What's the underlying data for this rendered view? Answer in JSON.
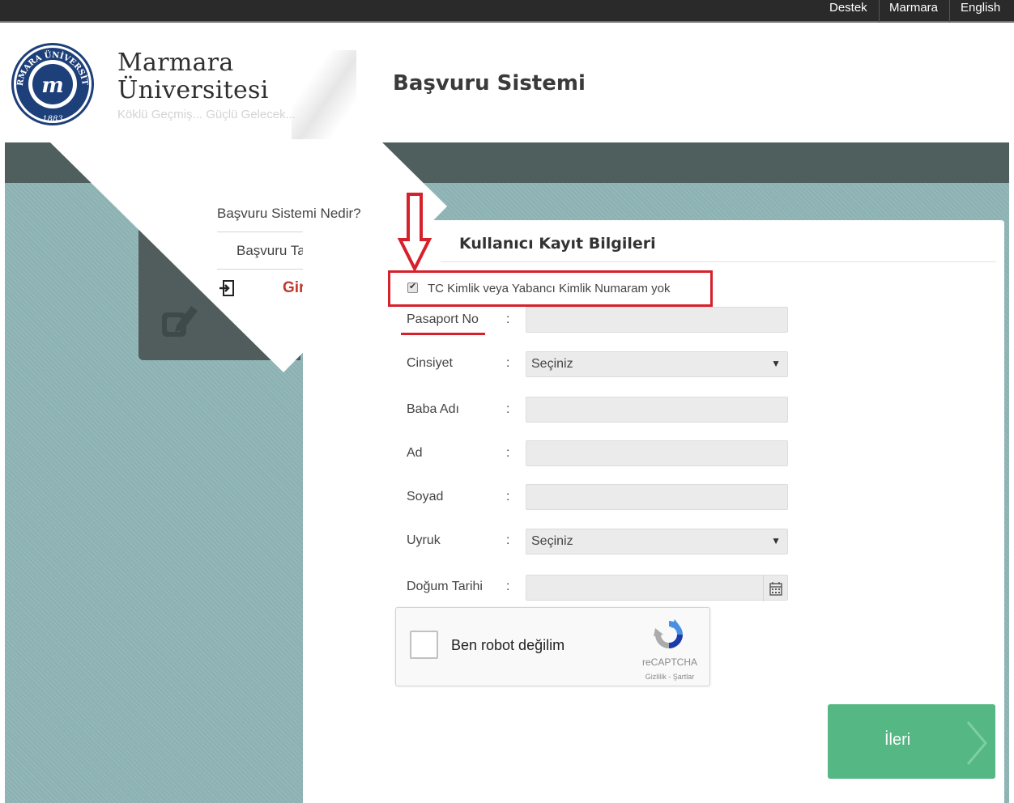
{
  "topbar": {
    "links": [
      "Destek",
      "Marmara",
      "English"
    ]
  },
  "header": {
    "seal_text": "MARMARA ÜNİVERSİTESİ",
    "seal_year": "1883",
    "brand_line1": "Marmara",
    "brand_line2": "Üniversitesi",
    "motto": "Köklü Geçmiş... Güçlü Gelecek...",
    "app_title": "Başvuru Sistemi"
  },
  "nav": {
    "items": [
      "Başvuru Sistemi Nedir?",
      "Başvuru Tarihleri"
    ],
    "login_label": "Giriş"
  },
  "form": {
    "title": "Kullanıcı Kayıt Bilgileri",
    "no_id_checkbox_label": "TC Kimlik veya Yabancı Kimlik Numaram yok",
    "no_id_checked": true,
    "colon": ":",
    "fields": {
      "passport": {
        "label": "Pasaport No",
        "value": ""
      },
      "gender": {
        "label": "Cinsiyet",
        "value": "Seçiniz"
      },
      "father": {
        "label": "Baba Adı",
        "value": ""
      },
      "first_name": {
        "label": "Ad",
        "value": ""
      },
      "last_name": {
        "label": "Soyad",
        "value": ""
      },
      "nationality": {
        "label": "Uyruk",
        "value": "Seçiniz"
      },
      "birth_date": {
        "label": "Doğum Tarihi",
        "value": ""
      }
    },
    "captcha": {
      "label": "Ben robot değilim",
      "brand": "reCAPTCHA",
      "links": "Gizlilik - Şartlar"
    },
    "next_label": "İleri"
  },
  "colors": {
    "accent_red": "#d6202b",
    "login_red": "#c0392b",
    "button_green": "#55b783",
    "band_dark": "#4f5f5e",
    "teal_bg": "#8db2b3"
  }
}
